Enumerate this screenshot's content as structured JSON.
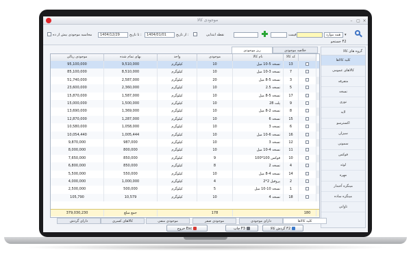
{
  "window": {
    "title": "موجودی کالا",
    "close_glyph": "×",
    "max_glyph": "▢",
    "min_glyph": "–"
  },
  "toolbar": {
    "group_label": "جستجو F2",
    "group_value": "همه موارد",
    "price_label": "قیمت",
    "price_value": "",
    "qty_label": "نقطه ابتدایی",
    "qty_value": "",
    "up_to_date_label": "تا تاریخ :",
    "from_date_label": "از تاریخ :",
    "date_from": "1404/01/01",
    "date_to": "1404/12/29",
    "compute_label": "محاسبه موجودی بیش از ده",
    "dropdown_glyph": "▾"
  },
  "right_panel": {
    "header": "گروه های کالا",
    "items": [
      "کلیه کالاها",
      "کالاهای عمومی",
      "متفرقه",
      "نسخه",
      "نوری",
      "لایه",
      "اکسترسو",
      "سیزان",
      "سمونی",
      "فوکس",
      "لوئه",
      "مهره",
      "مینگزه آخندار",
      "مینگزه ساده",
      "تاوانی"
    ],
    "selected_index": 0
  },
  "subtabs": [
    "خلاصه موجودی",
    "ریز موجودی"
  ],
  "table": {
    "columns": [
      "",
      "کد کالا",
      "نام کالا",
      "موجودی",
      "واحد",
      "بهای تمام شده",
      "موجودی ریالی"
    ],
    "rows": [
      {
        "code": "13",
        "name": "نسخه 5-10 میل",
        "qty": "10",
        "unit": "کیلوگرم",
        "cost": "9,510,000",
        "total": "95,100,000"
      },
      {
        "code": "7",
        "name": "نسخه 3-10 میل",
        "qty": "10",
        "unit": "کیلوگرم",
        "cost": "8,510,000",
        "total": "85,100,000"
      },
      {
        "code": "3",
        "name": "نسخه 5-8 میل",
        "qty": "20",
        "unit": "کیلوگرم",
        "cost": "2,587,000",
        "total": "51,740,000"
      },
      {
        "code": "5",
        "name": "نسخه 2.5",
        "qty": "10",
        "unit": "کیلوگرم",
        "cost": "2,360,000",
        "total": "23,600,000"
      },
      {
        "code": "17",
        "name": "نسخه 5-8 میل",
        "qty": "10",
        "unit": "کیلوگرم",
        "cost": "1,587,000",
        "total": "15,870,000"
      },
      {
        "code": "9",
        "name": "پلت 28",
        "qty": "10",
        "unit": "کیلوگرم",
        "cost": "1,500,000",
        "total": "15,000,000"
      },
      {
        "code": "8",
        "name": "نسخه 2-8 میل",
        "qty": "10",
        "unit": "کیلوگرم",
        "cost": "1,369,000",
        "total": "13,690,000"
      },
      {
        "code": "15",
        "name": "نسخه 6",
        "qty": "10",
        "unit": "کیلوگرم",
        "cost": "1,287,000",
        "total": "12,870,000"
      },
      {
        "code": "6",
        "name": "نسخه 3",
        "qty": "10",
        "unit": "کیلوگرم",
        "cost": "1,058,000",
        "total": "10,580,000"
      },
      {
        "code": "16",
        "name": "نسخه 6-10 میل",
        "qty": "10",
        "unit": "کیلوگرم",
        "cost": "1,005,444",
        "total": "10,054,440"
      },
      {
        "code": "12",
        "name": "نسخه 3",
        "qty": "10",
        "unit": "کیلوگرم",
        "cost": "987,000",
        "total": "9,870,000"
      },
      {
        "code": "11",
        "name": "نسخه 4-10 میل",
        "qty": "10",
        "unit": "کیلوگرم",
        "cost": "800,000",
        "total": "8,000,000"
      },
      {
        "code": "10",
        "name": "فوکس 100*100",
        "qty": "9",
        "unit": "کیلوگرم",
        "cost": "850,000",
        "total": "7,650,000"
      },
      {
        "code": "4",
        "name": "نسخه 2",
        "qty": "8",
        "unit": "کیلوگرم",
        "cost": "850,000",
        "total": "6,800,000"
      },
      {
        "code": "14",
        "name": "نسخه 4-8 میل",
        "qty": "10",
        "unit": "کیلوگرم",
        "cost": "550,000",
        "total": "5,500,000"
      },
      {
        "code": "2",
        "name": "پروفیل 2*2",
        "qty": "4",
        "unit": "کیلوگرم",
        "cost": "1,000,000",
        "total": "4,000,000"
      },
      {
        "code": "1",
        "name": "نسخه 10-10 میل",
        "qty": "5",
        "unit": "کیلوگرم",
        "cost": "500,000",
        "total": "2,500,000"
      },
      {
        "code": "18",
        "name": "نسخه 4",
        "qty": "10",
        "unit": "کیلوگرم",
        "cost": "10,579",
        "total": "105,790"
      }
    ],
    "totals": {
      "count": "180",
      "qty": "178",
      "cost_label": "جمع مبلغ",
      "total": "379,030,230"
    },
    "selected_index": 0
  },
  "bottom_tabs": [
    "کلیه کالاها",
    "دارای موجودی",
    "موجودی صفر",
    "موجودی منفی",
    "کالاهای کسری",
    "دارای گردش"
  ],
  "bottom_tabs_active": 0,
  "buttons": {
    "turnover": "گردش کالا F2",
    "print": "چاپ F3",
    "exit": "خروج Esc"
  }
}
